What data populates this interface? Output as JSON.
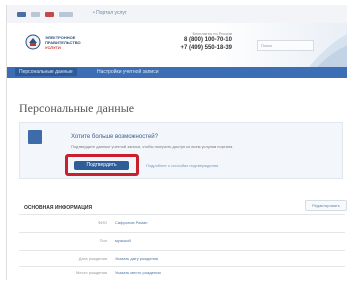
{
  "topbar": {
    "link": "• Портал услуг"
  },
  "header": {
    "logo_line1": "ЭЛЕКТРОННОЕ",
    "logo_line2": "ПРАВИТЕЛЬСТВО",
    "logo_line3": "УСЛУГИ",
    "phones_caption": "Бесплатно по России",
    "phone1": "8 (800) 100-70-10",
    "phone2": "+7 (499) 550-18-39",
    "search_placeholder": "Поиск"
  },
  "nav": {
    "items": [
      {
        "label": "Персональные данные"
      },
      {
        "label": "Настройки учетной записи"
      }
    ]
  },
  "page_title": "Персональные данные",
  "panel": {
    "question": "Хотите больше возможностей?",
    "description": "Подтвердите данные учетной записи, чтобы получить доступ ко всем услугам портала",
    "confirm_button": "Подтвердить",
    "more_link": "Подробнее о способах подтверждения"
  },
  "section": {
    "title": "ОСНОВНАЯ ИНФОРМАЦИЯ",
    "edit_button": "Редактировать"
  },
  "rows": [
    {
      "label": "ФИО",
      "value": "Сафронов Роман"
    },
    {
      "label": "Пол",
      "value": "мужской"
    },
    {
      "label": "Дата рождения",
      "value": "Указать дату рождения"
    },
    {
      "label": "Место рождения",
      "value": "Указать место рождения"
    }
  ],
  "colors": {
    "nav": "#3b6eb5",
    "confirm": "#2f5d9a",
    "highlight": "#c8202c"
  }
}
